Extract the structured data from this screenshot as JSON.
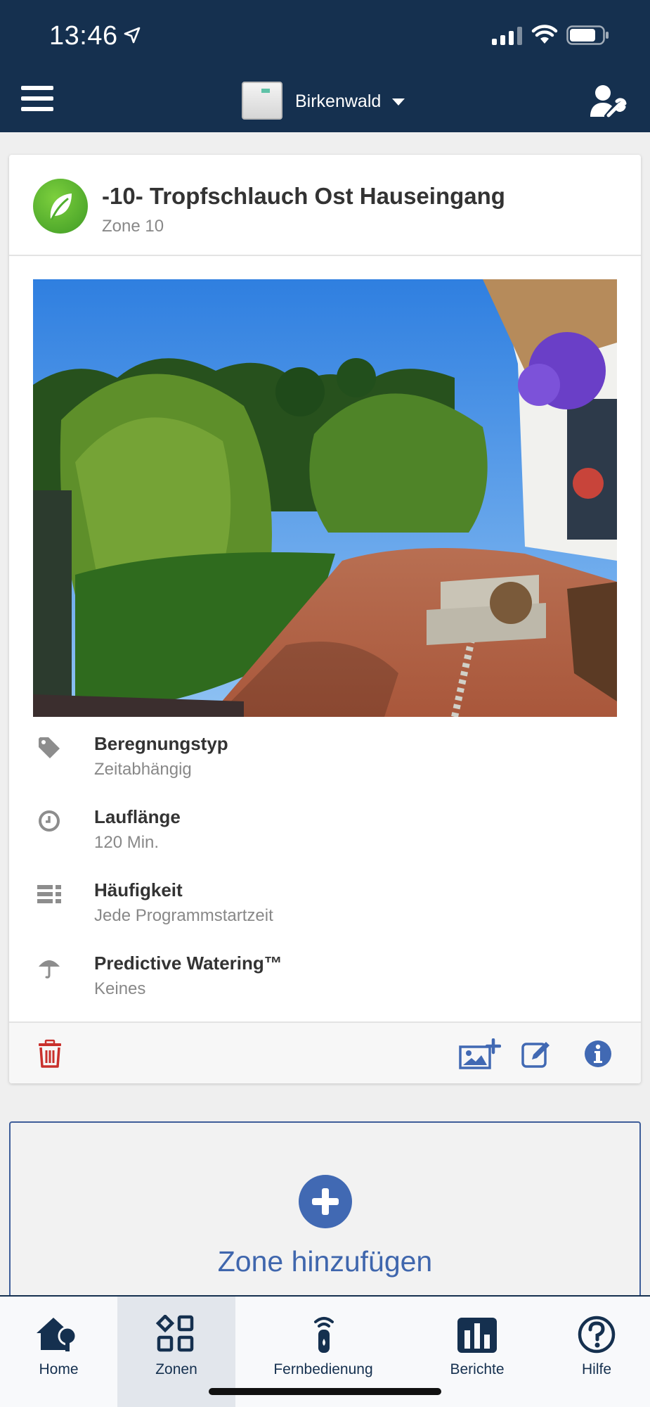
{
  "status_bar": {
    "time": "13:46"
  },
  "header": {
    "controller_name": "Birkenwald"
  },
  "zone": {
    "title": "-10- Tropfschlauch Ost Hauseingang",
    "subtitle": "Zone 10",
    "details": [
      {
        "icon": "tag-icon",
        "label": "Beregnungstyp",
        "value": "Zeitabhängig"
      },
      {
        "icon": "clock-icon",
        "label": "Lauflänge",
        "value": "120 Min."
      },
      {
        "icon": "frequency-icon",
        "label": "Häufigkeit",
        "value": "Jede Programmstartzeit"
      },
      {
        "icon": "umbrella-icon",
        "label": "Predictive Watering™",
        "value": "Keines"
      }
    ]
  },
  "add_zone": {
    "label": "Zone hinzufügen"
  },
  "tabs": [
    {
      "icon": "home-icon",
      "label": "Home",
      "active": false
    },
    {
      "icon": "zones-grid-icon",
      "label": "Zonen",
      "active": true
    },
    {
      "icon": "remote-icon",
      "label": "Fernbedienung",
      "active": false
    },
    {
      "icon": "reports-icon",
      "label": "Berichte",
      "active": false
    },
    {
      "icon": "help-icon",
      "label": "Hilfe",
      "active": false
    }
  ],
  "colors": {
    "header_bg": "#15304f",
    "accent_blue": "#4169b3",
    "delete_red": "#c9302c",
    "zone_green": "#4fae2c"
  }
}
